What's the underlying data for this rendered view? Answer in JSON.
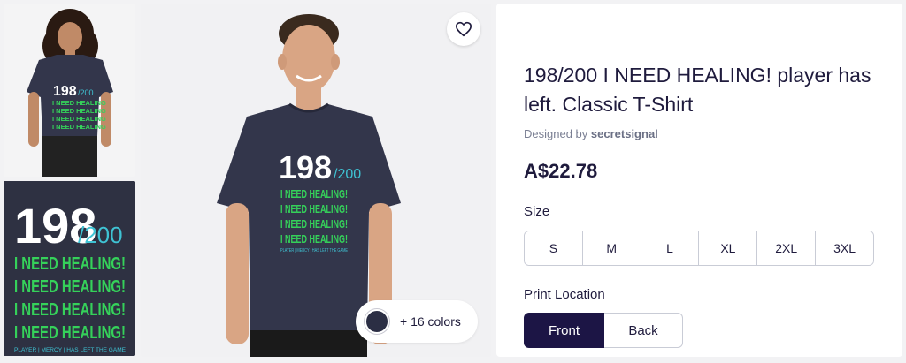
{
  "product": {
    "title": "198/200 I NEED HEALING! player has left. Classic T-Shirt",
    "designed_by_prefix": "Designed by",
    "designer": "secretsignal",
    "price": "A$22.78"
  },
  "graphic": {
    "number": "198",
    "slash_total": "/200",
    "line": "I NEED HEALING!",
    "footer": "PLAYER | MERCY | HAS LEFT THE GAME"
  },
  "colors": {
    "label": "+ 16 colors",
    "selected_swatch": "#2b2e44"
  },
  "size": {
    "label": "Size",
    "options": [
      "S",
      "M",
      "L",
      "XL",
      "2XL",
      "3XL"
    ]
  },
  "print_location": {
    "label": "Print Location",
    "options": [
      "Front",
      "Back"
    ],
    "selected": "Front"
  },
  "theme": {
    "shirt": "#33364b",
    "graphic_green": "#35d15a",
    "graphic_teal": "#3fc3d4",
    "accent_navy": "#1c1545"
  }
}
